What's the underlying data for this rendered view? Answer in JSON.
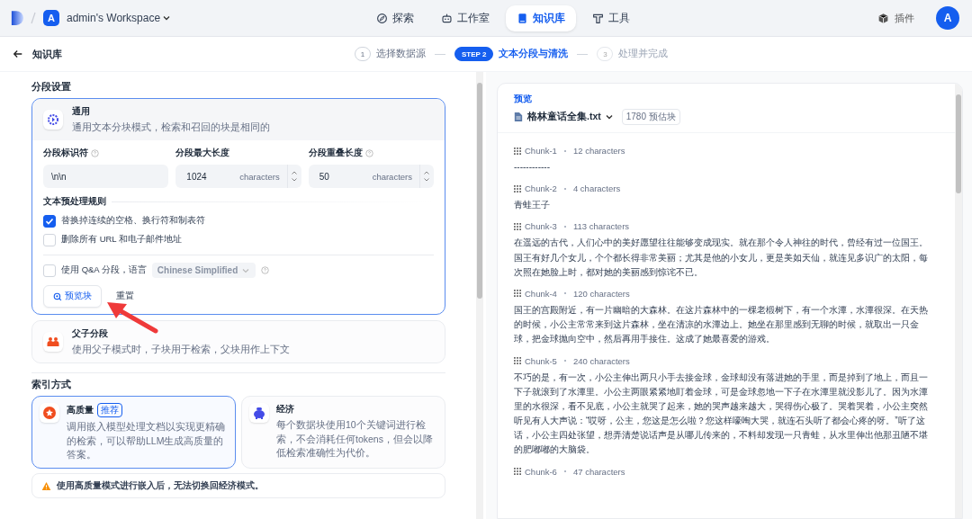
{
  "nav": {
    "workspace_initial": "A",
    "workspace_name": "admin's Workspace",
    "tabs": [
      {
        "label": "探索",
        "selected": false
      },
      {
        "label": "工作室",
        "selected": false
      },
      {
        "label": "知识库",
        "selected": true
      },
      {
        "label": "工具",
        "selected": false
      }
    ],
    "plugins": "插件",
    "avatar": "A"
  },
  "header": {
    "title": "知识库",
    "steps": [
      {
        "number": "1",
        "label": "选择数据源",
        "selected": false,
        "disabled": false
      },
      {
        "number": "STEP 2",
        "label": "文本分段与清洗",
        "selected": true,
        "disabled": false
      },
      {
        "number": "3",
        "label": "处理并完成",
        "selected": false,
        "disabled": true
      }
    ]
  },
  "segment": {
    "title": "分段设置",
    "general": {
      "title": "通用",
      "desc": "通用文本分块模式，检索和召回的块是相同的",
      "selected": true
    },
    "fields": [
      {
        "label": "分段标识符",
        "help": true,
        "value": "\\n\\n",
        "kind": "text"
      },
      {
        "label": "分段最大长度",
        "help": false,
        "value": "1024",
        "unit": "characters",
        "kind": "number"
      },
      {
        "label": "分段重叠长度",
        "help": true,
        "value": "50",
        "unit": "characters",
        "kind": "number"
      }
    ],
    "rules_title": "文本预处理规则",
    "rules": [
      {
        "label": "替换掉连续的空格、换行符和制表符",
        "checked": true
      },
      {
        "label": "删除所有 URL 和电子邮件地址",
        "checked": false
      }
    ],
    "qa": {
      "label": "使用 Q&A 分段，语言",
      "checked": false,
      "language": "Chinese Simplified",
      "disabled": true
    },
    "preview_button": "预览块",
    "reset_button": "重置",
    "parent_child": {
      "title": "父子分段",
      "desc": "使用父子模式时，子块用于检索，父块用作上下文",
      "selected": false
    }
  },
  "index": {
    "title": "索引方式",
    "options": [
      {
        "title": "高质量",
        "badge": "推荐",
        "desc": "调用嵌入模型处理文档以实现更精确的检索，可以帮助LLM生成高质量的答案。",
        "selected": true
      },
      {
        "title": "经济",
        "desc": "每个数据块使用10个关键词进行检索，不会消耗任何tokens，但会以降低检索准确性为代价。",
        "selected": false
      }
    ],
    "warning": "使用高质量模式进行嵌入后，无法切换回经济模式。"
  },
  "preview": {
    "label": "预览",
    "file": "格林童话全集.txt",
    "estimate": "1780 预估块",
    "chunks": [
      {
        "title": "Chunk-1",
        "count": "12 characters",
        "text": "------------"
      },
      {
        "title": "Chunk-2",
        "count": "4 characters",
        "text": "青蛙王子"
      },
      {
        "title": "Chunk-3",
        "count": "113 characters",
        "text": "在遥远的古代，人们心中的美好愿望往往能够变成现实。就在那个令人神往的时代，曾经有过一位国王。国王有好几个女儿，个个都长得非常美丽；尤其是他的小女儿，更是美如天仙，就连见多识广的太阳，每次照在她脸上时，都对她的美丽感到惊诧不已。"
      },
      {
        "title": "Chunk-4",
        "count": "120 characters",
        "text": "国王的宫殿附近，有一片幽暗的大森林。在这片森林中的一棵老椴树下，有一个水潭，水潭很深。在天热的时候，小公主常常来到这片森林，坐在清凉的水潭边上。她坐在那里感到无聊的时候，就取出一只金球，把金球抛向空中，然后再用手接住。这成了她最喜爱的游戏。"
      },
      {
        "title": "Chunk-5",
        "count": "240 characters",
        "text": "不巧的是，有一次，小公主伸出两只小手去接金球，金球却没有落进她的手里，而是掉到了地上，而且一下子就滚到了水潭里。小公主两眼紧紧地盯着金球，可是金球忽地一下子在水潭里就没影儿了。因为水潭里的水很深，看不见底，小公主就哭了起来，她的哭声越来越大，哭得伤心极了。哭着哭着，小公主突然听见有人大声说：“哎呀，公主，您这是怎么啦？您这样嚎啕大哭，就连石头听了都会心疼的呀。”听了这话，小公主四处张望，想弄清楚说话声是从哪儿传来的，不料却发现一只青蛙，从水里伸出他那丑陋不堪的肥嘟嘟的大脑袋。"
      },
      {
        "title": "Chunk-6",
        "count": "47 characters"
      }
    ]
  }
}
